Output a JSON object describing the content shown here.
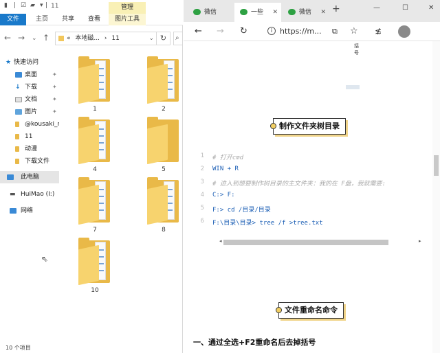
{
  "explorer": {
    "title": "11",
    "ribbon": {
      "manage_tab": "管理",
      "tabs": [
        "文件",
        "主页",
        "共享",
        "查看"
      ],
      "picture_tools_tab": "图片工具"
    },
    "address": {
      "path_prefix": "«",
      "path_parts": [
        "本地磁...",
        "11"
      ],
      "path_sep": "›"
    },
    "nav": {
      "quick_access": "快速访问",
      "items": [
        {
          "label": "桌面",
          "icon": "desktop-icon",
          "pinned": true
        },
        {
          "label": "下载",
          "icon": "download-icon",
          "pinned": true
        },
        {
          "label": "文档",
          "icon": "document-icon",
          "pinned": true
        },
        {
          "label": "图片",
          "icon": "picture-icon",
          "pinned": true
        },
        {
          "label": "@kousaki_r",
          "icon": "folder-icon",
          "pinned": false
        },
        {
          "label": "11",
          "icon": "folder-icon",
          "pinned": false
        },
        {
          "label": "动漫",
          "icon": "folder-icon",
          "pinned": false
        },
        {
          "label": "下载文件",
          "icon": "folder-icon",
          "pinned": false
        }
      ],
      "this_pc": "此电脑",
      "drive": "HuiMao (I:)",
      "network": "网络"
    },
    "folders": [
      "1",
      "2",
      "4",
      "5",
      "7",
      "8",
      "10"
    ],
    "status": "10 个项目"
  },
  "browser": {
    "tabs": [
      {
        "label": "微信",
        "active": false
      },
      {
        "label": "一些",
        "active": true
      },
      {
        "label": "微信",
        "active": false
      }
    ],
    "url": "https://m...",
    "page": {
      "image_tag": "括号",
      "heading1": "制作文件夹树目录",
      "code_lines": [
        {
          "no": "1",
          "text": "# 打开cmd",
          "kind": "comment"
        },
        {
          "no": "2",
          "text": "WIN + R",
          "kind": "kw"
        },
        {
          "no": "3",
          "text": "# 进入到想要制作树目录的主文件夹：我的在 F盘，我就需要:",
          "kind": "comment"
        },
        {
          "no": "4",
          "text": "C:> F:",
          "kind": "kw"
        },
        {
          "no": "5",
          "text": "F:> cd /目录/目录",
          "kind": "kw"
        },
        {
          "no": "6",
          "text": "F:\\目录\\目录> tree /f >tree.txt",
          "kind": "kw"
        }
      ],
      "heading2": "文件重命名命令",
      "section_title": "一、通过全选+F2重命名后去掉括号"
    }
  },
  "colors": {
    "accent": "#1979ca",
    "manage_tab": "#f9f0b5",
    "folder": "#e9b948",
    "heading_shadow": "#f0d48a",
    "wechat": "#2ea143"
  }
}
